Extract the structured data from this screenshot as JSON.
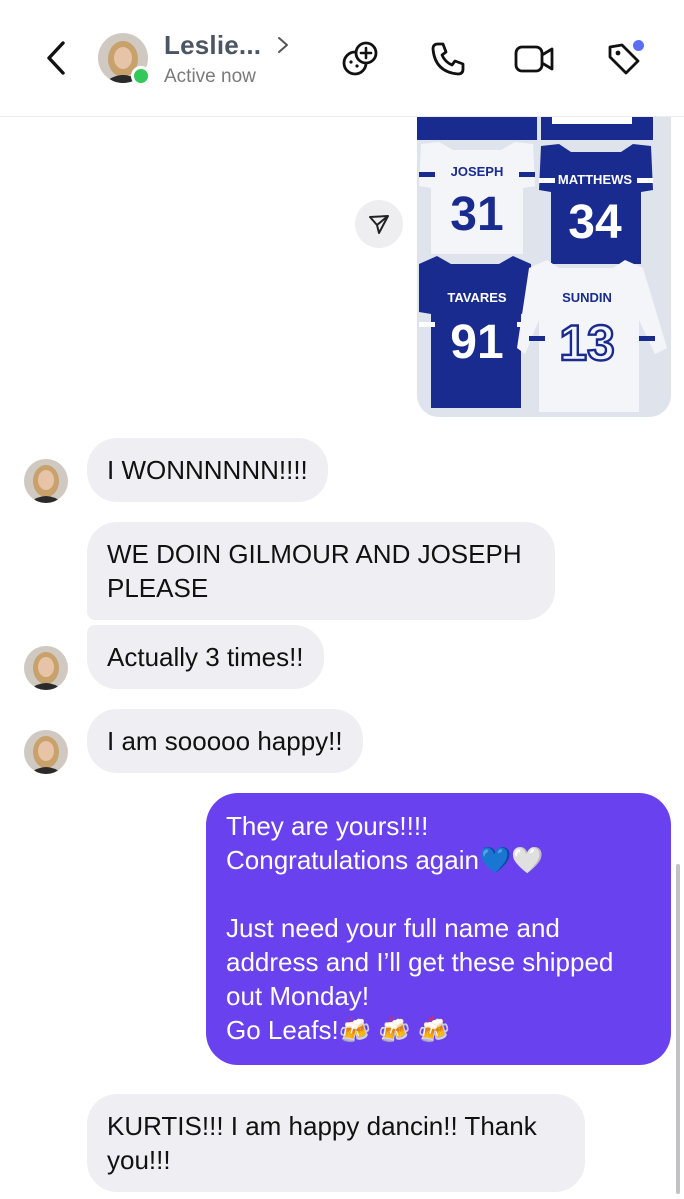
{
  "header": {
    "back_icon": "chevron-left-icon",
    "contact_name": "Leslie...",
    "status": "Active now",
    "actions": [
      {
        "icon": "new-effect-icon"
      },
      {
        "icon": "phone-icon"
      },
      {
        "icon": "video-camera-icon"
      },
      {
        "icon": "tag-icon"
      }
    ]
  },
  "shared_image": {
    "jerseys": [
      {
        "name": "JOSEPH",
        "number": "31",
        "color": "white"
      },
      {
        "name": "MATTHEWS",
        "number": "34",
        "color": "blue"
      },
      {
        "name": "TAVARES",
        "number": "91",
        "color": "blue"
      },
      {
        "name": "SUNDIN",
        "number": "13",
        "color": "white"
      }
    ]
  },
  "messages": [
    {
      "sender": "contact",
      "text": "I WONNNNNN!!!!"
    },
    {
      "sender": "contact",
      "text": "WE DOIN GILMOUR AND JOSEPH PLEASE"
    },
    {
      "sender": "contact",
      "text": "Actually 3 times!!"
    },
    {
      "sender": "contact",
      "text": "I am sooooo happy!!"
    },
    {
      "sender": "me",
      "text": "They are yours!!!!\nCongratulations again💙🤍\n\nJust need your full name and address and I’ll get these shipped out Monday!\nGo Leafs!🍻 🍻 🍻"
    },
    {
      "sender": "contact",
      "text": "KURTIS!!! I am happy dancin!! Thank you!!!"
    }
  ],
  "colors": {
    "outgoing_bubble": "#6941ef",
    "incoming_bubble": "#efeff3",
    "online": "#34c759",
    "leafs_blue": "#1a2b8f"
  }
}
